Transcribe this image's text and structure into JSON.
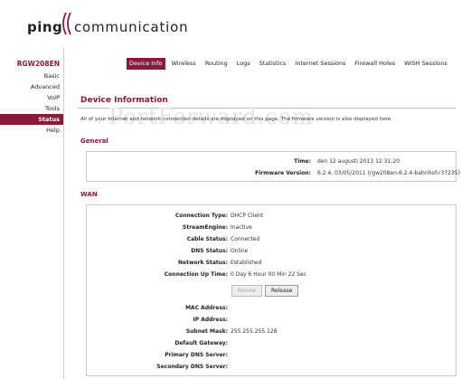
{
  "header": {
    "logo_ping": "ping",
    "logo_comm": "communication"
  },
  "sidebar": {
    "model": "RGW208EN",
    "items": [
      {
        "label": "Basic"
      },
      {
        "label": "Advanced"
      },
      {
        "label": "VoIP"
      },
      {
        "label": "Tools"
      },
      {
        "label": "Status",
        "active": true
      },
      {
        "label": "Help"
      }
    ]
  },
  "topnav": {
    "items": [
      {
        "label": "Device Info",
        "active": true
      },
      {
        "label": "Wireless"
      },
      {
        "label": "Routing"
      },
      {
        "label": "Logs"
      },
      {
        "label": "Statistics"
      },
      {
        "label": "Internet Sessions"
      },
      {
        "label": "Firewall Holes"
      },
      {
        "label": "WISH Sessions"
      }
    ]
  },
  "main": {
    "title": "Device Information",
    "description": "All of your Internet and network connection details are displayed on this page. The firmware version is also displayed here.",
    "watermark": "PortForward.com"
  },
  "general": {
    "title": "General",
    "time_label": "Time:",
    "time_value": "den 12 augusti 2013 12:31:20",
    "firmware_label": "Firmware Version:",
    "firmware_value": "6.2.4, 03/05/2011 (rgw208en-6.2.4-bahnhof-r37235)"
  },
  "wan": {
    "title": "WAN",
    "rows": [
      {
        "label": "Connection Type:",
        "value": "DHCP Client"
      },
      {
        "label": "StreamEngine:",
        "value": "Inactive"
      },
      {
        "label": "Cable Status:",
        "value": "Connected"
      },
      {
        "label": "DNS Status:",
        "value": "Online"
      },
      {
        "label": "Network Status:",
        "value": "Established"
      },
      {
        "label": "Connection Up Time:",
        "value": "0 Day 6 Hour 00 Min 22 Sec"
      }
    ],
    "renew_label": "Renew",
    "release_label": "Release",
    "rows2": [
      {
        "label": "MAC Address:",
        "value": ""
      },
      {
        "label": "IP Address:",
        "value": ""
      },
      {
        "label": "Subnet Mask:",
        "value": "255.255.255.128"
      },
      {
        "label": "Default Gateway:",
        "value": ""
      },
      {
        "label": "Primary DNS Server:",
        "value": ""
      },
      {
        "label": "Secondary DNS Server:",
        "value": ""
      }
    ]
  },
  "colors": {
    "accent": "#8b1a3a",
    "border": "#c9c9c9"
  }
}
